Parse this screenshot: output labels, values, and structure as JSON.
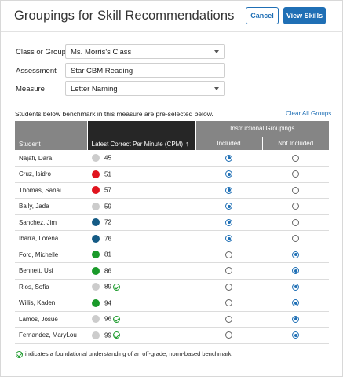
{
  "header": {
    "title": "Groupings for Skill Recommendations",
    "cancel_label": "Cancel",
    "view_label": "View Skills"
  },
  "form": {
    "class_label": "Class or Group",
    "class_value": "Ms. Morris's Class",
    "assessment_label": "Assessment",
    "assessment_value": "Star CBM Reading",
    "measure_label": "Measure",
    "measure_value": "Letter Naming"
  },
  "note": "Students below benchmark in this measure are pre-selected below.",
  "clear_all_label": "Clear All Groups",
  "table": {
    "col_student": "Student",
    "col_cpm": "Latest Correct Per Minute (CPM)",
    "sort_icon": "arrow-up-icon",
    "group_header": "Instructional Groupings",
    "col_included": "Included",
    "col_not_included": "Not Included",
    "rows": [
      {
        "name": "Najafi, Dara",
        "score": "45",
        "color": "#cccccc",
        "check": false,
        "included": true
      },
      {
        "name": "Cruz, Isidro",
        "score": "51",
        "color": "#e0141e",
        "check": false,
        "included": true
      },
      {
        "name": "Thomas, Sanai",
        "score": "57",
        "color": "#e0141e",
        "check": false,
        "included": true
      },
      {
        "name": "Baily, Jada",
        "score": "59",
        "color": "#cccccc",
        "check": false,
        "included": true
      },
      {
        "name": "Sanchez, Jim",
        "score": "72",
        "color": "#155b85",
        "check": false,
        "included": true
      },
      {
        "name": "Ibarra, Lorena",
        "score": "76",
        "color": "#155b85",
        "check": false,
        "included": true
      },
      {
        "name": "Ford, Michelle",
        "score": "81",
        "color": "#1a9a2a",
        "check": false,
        "included": false
      },
      {
        "name": "Bennett, Usi",
        "score": "86",
        "color": "#1a9a2a",
        "check": false,
        "included": false
      },
      {
        "name": "Rios, Sofia",
        "score": "89",
        "color": "#cccccc",
        "check": true,
        "included": false
      },
      {
        "name": "Willis, Kaden",
        "score": "94",
        "color": "#1a9a2a",
        "check": false,
        "included": false
      },
      {
        "name": "Lamos, Josue",
        "score": "96",
        "color": "#cccccc",
        "check": true,
        "included": false
      },
      {
        "name": "Fernandez, MaryLou",
        "score": "99",
        "color": "#cccccc",
        "check": true,
        "included": false
      }
    ]
  },
  "legend_text": "indicates a foundational understanding of an off-grade, norm-based benchmark",
  "colors": {
    "accent": "#1f6fb5",
    "red": "#e0141e",
    "blue": "#155b85",
    "green": "#1a9a2a",
    "gray": "#cccccc"
  }
}
